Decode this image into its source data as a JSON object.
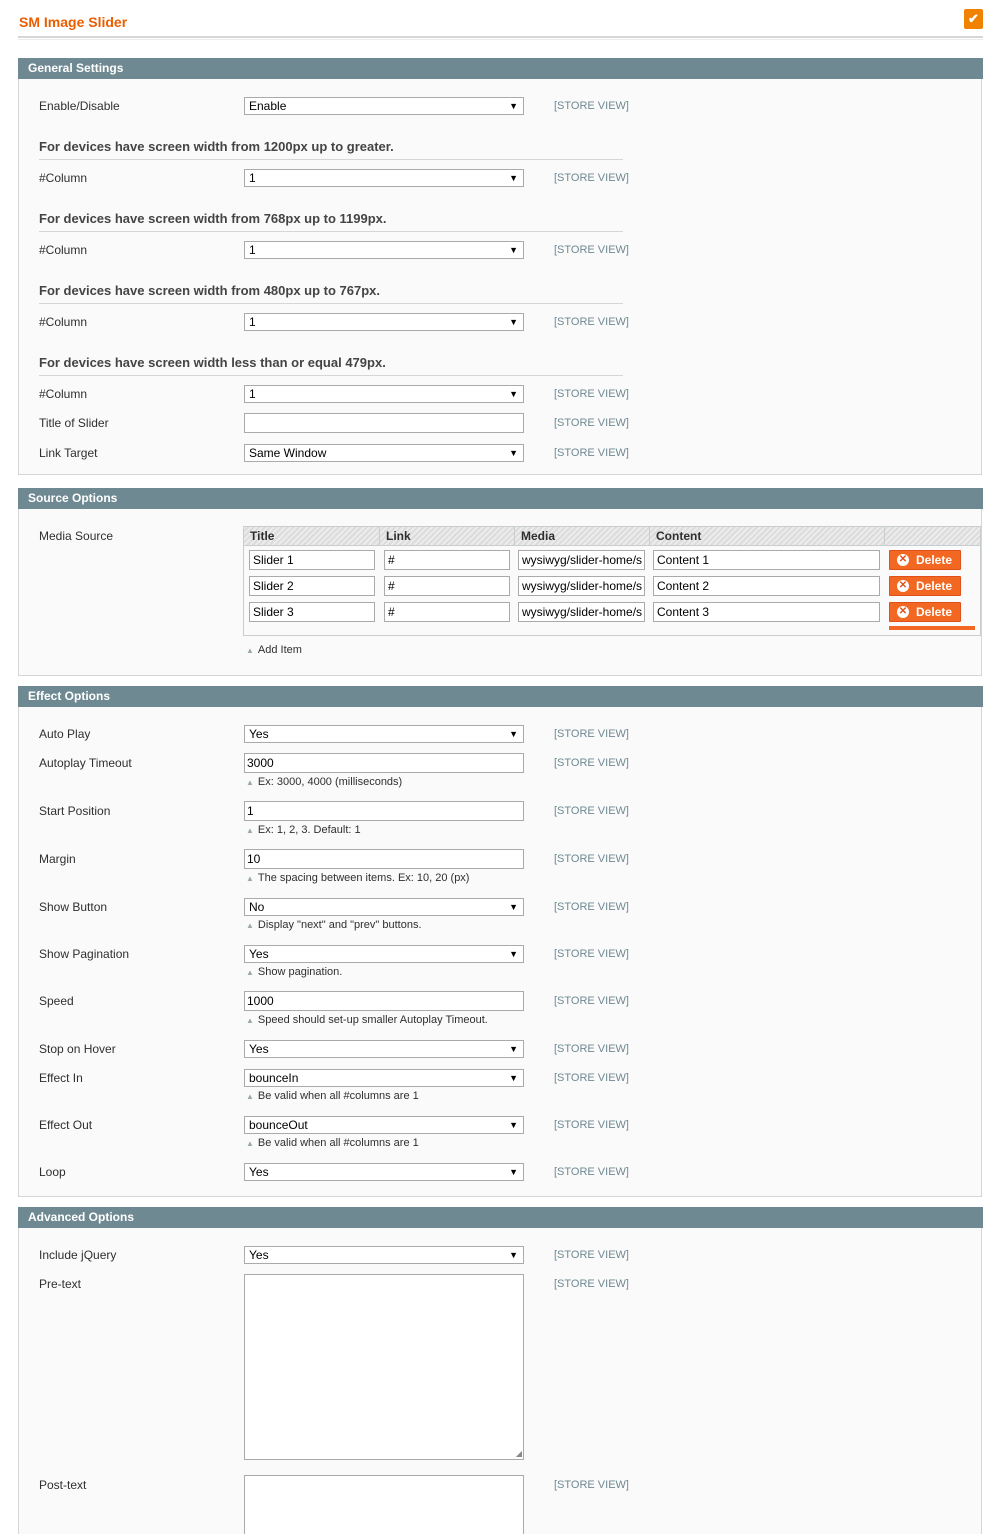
{
  "page": {
    "title": "SM Image Slider",
    "save_icon": "check-icon"
  },
  "scope_label": "[STORE VIEW]",
  "general": {
    "heading": "General Settings",
    "enable_label": "Enable/Disable",
    "enable_value": "Enable",
    "dev1_heading": "For devices have screen width from 1200px up to greater.",
    "dev2_heading": "For devices have screen width from 768px up to 1199px.",
    "dev3_heading": "For devices have screen width from 480px up to 767px.",
    "dev4_heading": "For devices have screen width less than or equal 479px.",
    "column_label": "#Column",
    "column_value": "1",
    "title_label": "Title of Slider",
    "title_value": "",
    "link_target_label": "Link Target",
    "link_target_value": "Same Window"
  },
  "source": {
    "heading": "Source Options",
    "media_source_label": "Media Source",
    "columns": [
      "Title",
      "Link",
      "Media",
      "Content"
    ],
    "rows": [
      {
        "title": "Slider 1",
        "link": "#",
        "media": "wysiwyg/slider-home/s",
        "content": "Content 1"
      },
      {
        "title": "Slider 2",
        "link": "#",
        "media": "wysiwyg/slider-home/s",
        "content": "Content 2"
      },
      {
        "title": "Slider 3",
        "link": "#",
        "media": "wysiwyg/slider-home/s",
        "content": "Content 3"
      }
    ],
    "delete_label": "Delete",
    "add_item_label": "Add Item"
  },
  "effect": {
    "heading": "Effect Options",
    "autoplay_label": "Auto Play",
    "autoplay_value": "Yes",
    "timeout_label": "Autoplay Timeout",
    "timeout_value": "3000",
    "timeout_note": "Ex: 3000, 4000 (milliseconds)",
    "start_label": "Start Position",
    "start_value": "1",
    "start_note": "Ex: 1, 2, 3. Default: 1",
    "margin_label": "Margin",
    "margin_value": "10",
    "margin_note": "The spacing between items. Ex: 10, 20 (px)",
    "show_button_label": "Show Button",
    "show_button_value": "No",
    "show_button_note": "Display \"next\" and \"prev\" buttons.",
    "show_pagination_label": "Show Pagination",
    "show_pagination_value": "Yes",
    "show_pagination_note": "Show pagination.",
    "speed_label": "Speed",
    "speed_value": "1000",
    "speed_note": "Speed should set-up smaller Autoplay Timeout.",
    "stop_hover_label": "Stop on Hover",
    "stop_hover_value": "Yes",
    "effect_in_label": "Effect In",
    "effect_in_value": "bounceIn",
    "effect_in_note": "Be valid when all #columns are 1",
    "effect_out_label": "Effect Out",
    "effect_out_value": "bounceOut",
    "effect_out_note": "Be valid when all #columns are 1",
    "loop_label": "Loop",
    "loop_value": "Yes"
  },
  "advanced": {
    "heading": "Advanced Options",
    "jquery_label": "Include jQuery",
    "jquery_value": "Yes",
    "pretext_label": "Pre-text",
    "posttext_label": "Post-text"
  }
}
